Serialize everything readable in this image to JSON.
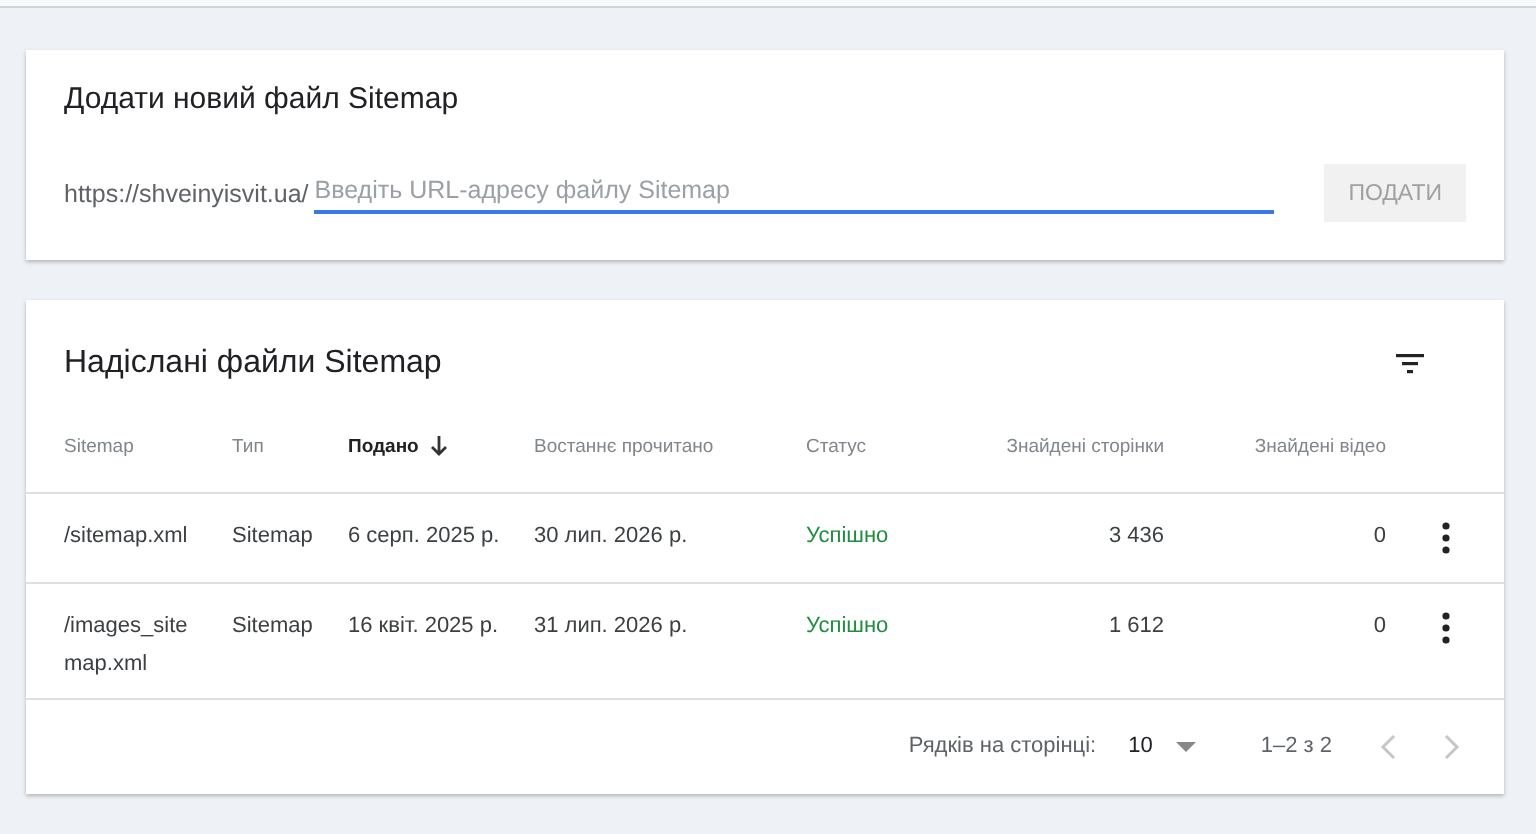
{
  "add_card": {
    "title": "Додати новий файл Sitemap",
    "url_prefix": "https://shveinyisvit.ua/",
    "placeholder": "Введіть URL-адресу файлу Sitemap",
    "submit": {
      "label": "ПОДАТИ",
      "disabled": true
    }
  },
  "submitted_card": {
    "title": "Надіслані файли Sitemap",
    "columns": [
      {
        "label": "Sitemap",
        "sorted": false
      },
      {
        "label": "Тип",
        "sorted": false
      },
      {
        "label": "Подано",
        "sorted": true
      },
      {
        "label": "Востаннє прочитано",
        "sorted": false
      },
      {
        "label": "Статус",
        "sorted": false
      },
      {
        "label": "Знайдені сторінки",
        "sorted": false
      },
      {
        "label": "Знайдені відео",
        "sorted": false
      }
    ],
    "rows": [
      {
        "cells": [
          "/sitemap.xml",
          "Sitemap",
          "6 серп. 2025 р.",
          "30 лип. 2026 р.",
          "Успішно",
          "3 436",
          "0"
        ]
      },
      {
        "cells": [
          "/images_site map.xml",
          "Sitemap",
          "16 квіт. 2025 р.",
          "31 лип. 2026 р.",
          "Успішно",
          "1 612",
          "0"
        ]
      }
    ],
    "pagination": {
      "rows_label": "Рядків на сторінці:",
      "rows_value": "10",
      "range": "1–2 з 2",
      "prev_disabled": true,
      "next_disabled": true
    }
  }
}
